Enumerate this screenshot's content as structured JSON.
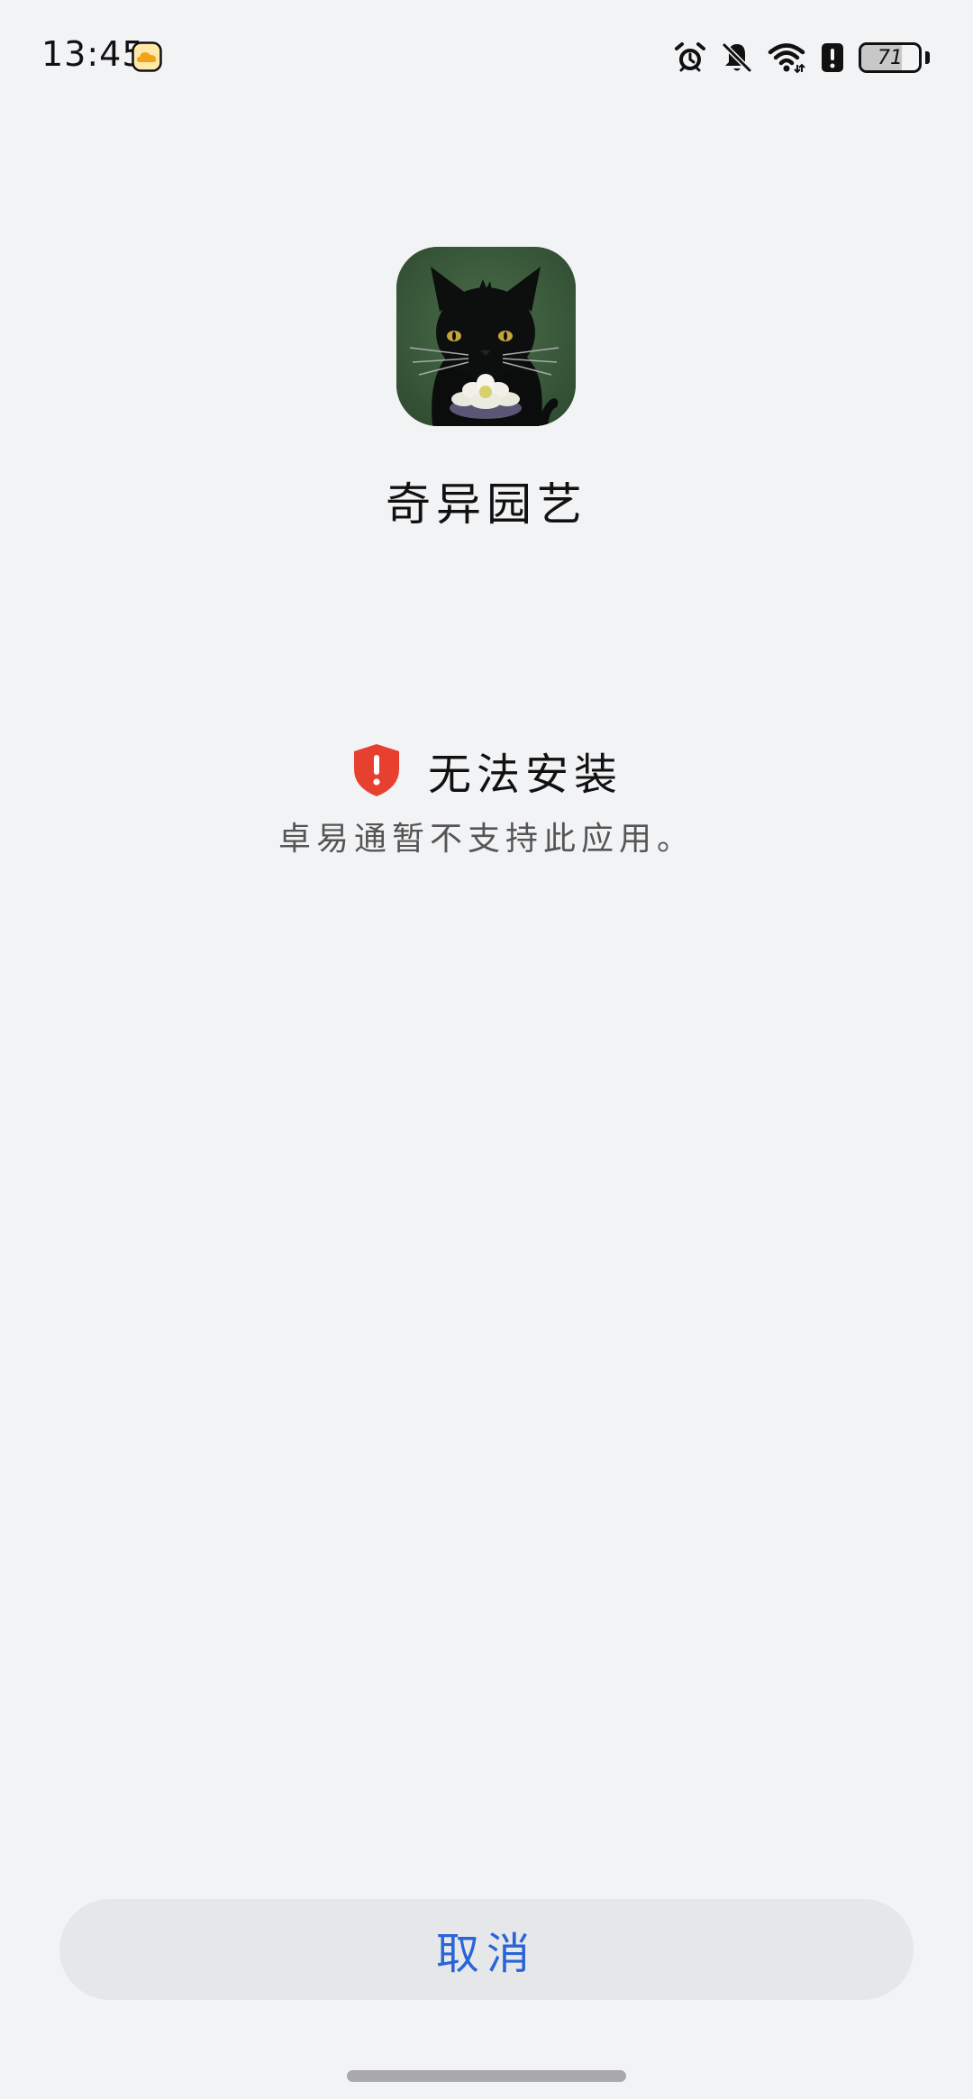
{
  "status_bar": {
    "time": "13:45",
    "battery_level": "71",
    "battery_fraction": 0.71,
    "icons": [
      "weather-cloud-icon",
      "alarm-icon",
      "mute-bell-icon",
      "wifi-icon",
      "alert-icon",
      "battery-icon"
    ]
  },
  "app": {
    "name": "奇异园艺",
    "icon": "black-cat-with-flower-app-icon"
  },
  "error": {
    "icon": "red-shield-warning-icon",
    "icon_color": "#e8402f",
    "title": "无法安装",
    "description": "卓易通暂不支持此应用。"
  },
  "actions": {
    "cancel_label": "取消",
    "cancel_color": "#2a64d8"
  },
  "colors": {
    "background": "#f2f3f5",
    "button_background": "#e6e7e9"
  }
}
